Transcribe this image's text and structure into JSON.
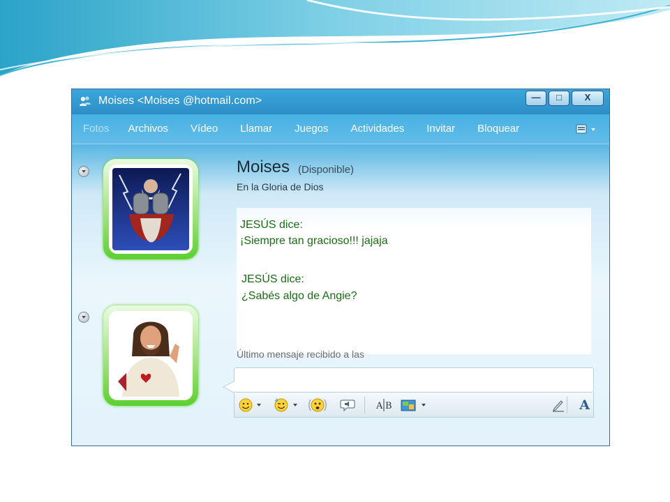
{
  "window": {
    "title": "Moises <Moises @hotmail.com>",
    "minimize_glyph": "—",
    "maximize_glyph": "□",
    "close_glyph": "X"
  },
  "menu": {
    "items": [
      {
        "label": "Fotos",
        "enabled": false
      },
      {
        "label": "Archivos",
        "enabled": true
      },
      {
        "label": "Vídeo",
        "enabled": true
      },
      {
        "label": "Llamar",
        "enabled": true
      },
      {
        "label": "Juegos",
        "enabled": true
      },
      {
        "label": "Actividades",
        "enabled": true
      },
      {
        "label": "Invitar",
        "enabled": true
      },
      {
        "label": "Bloquear",
        "enabled": true
      }
    ]
  },
  "contact": {
    "name": "Moises",
    "status": "(Disponible)",
    "personal_message": "En la Gloria de Dios"
  },
  "conversation": [
    {
      "sender": "JESÚS dice:",
      "text": "¡Siempre tan gracioso!!! jajaja"
    },
    {
      "sender": "JESÚS dice:",
      "text": "¿Sabés algo de Angie?"
    }
  ],
  "footer": {
    "last_message": "Último mensaje recibido a las"
  },
  "colors": {
    "chat_text": "#1a6b14",
    "titlebar": "#2d8fc6",
    "frame_glow": "#5ccf2f"
  },
  "icons": [
    "app-icon",
    "emoticon-icon",
    "wink-icon",
    "nudge-icon",
    "voice-clip-icon",
    "spellcheck-icon",
    "background-icon",
    "handwriting-icon",
    "font-icon"
  ]
}
